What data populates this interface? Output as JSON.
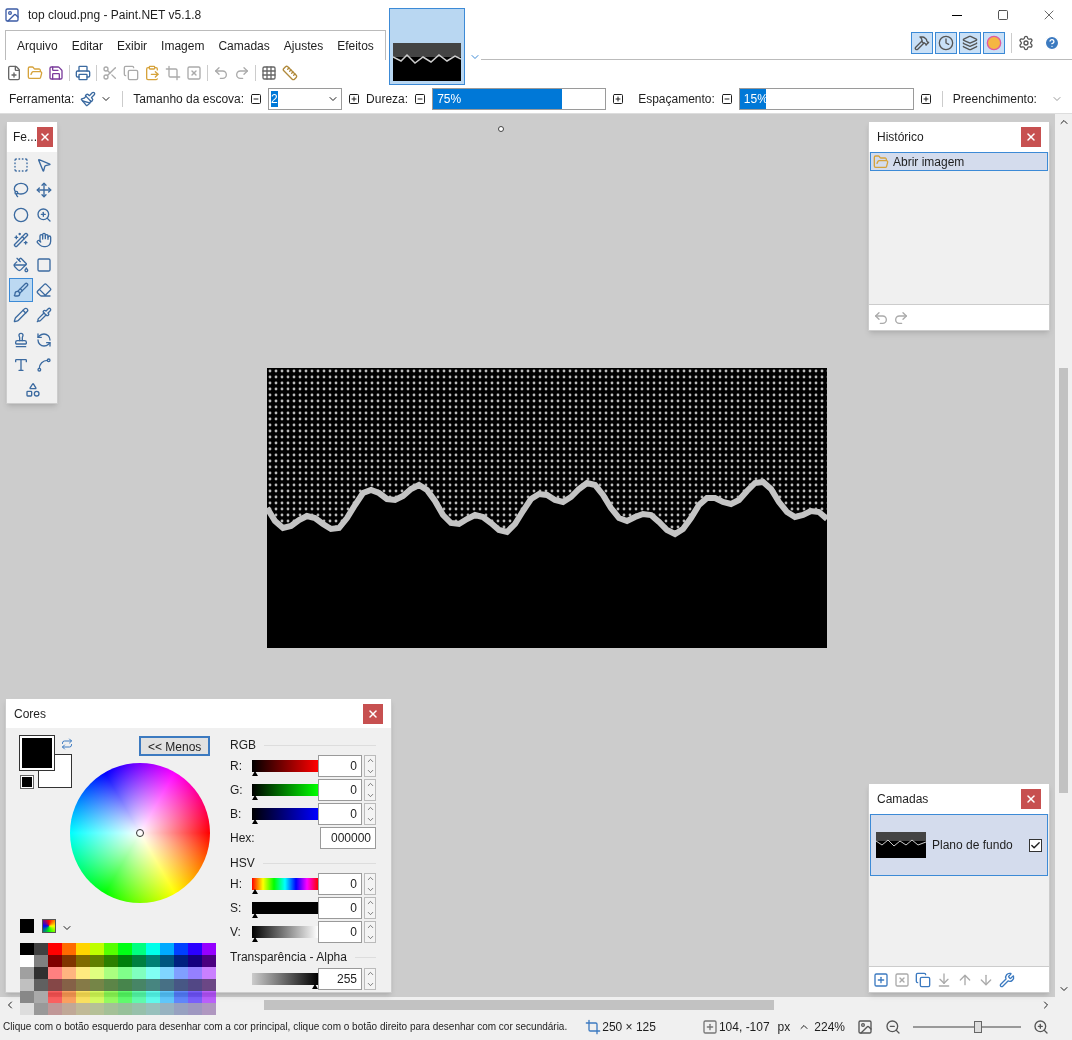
{
  "window": {
    "title": "top cloud.png - Paint.NET v5.1.8"
  },
  "menu": [
    "Arquivo",
    "Editar",
    "Exibir",
    "Imagem",
    "Camadas",
    "Ajustes",
    "Efeitos"
  ],
  "image_tabs": [
    {
      "selected": true
    }
  ],
  "panel_toggles": [
    {
      "selected": true
    },
    {
      "selected": true
    },
    {
      "selected": true
    },
    {
      "selected": true
    }
  ],
  "tool_options": {
    "tool_label": "Ferramenta:",
    "brush_size_label": "Tamanho da escova:",
    "brush_size": "2",
    "hardness_label": "Dureza:",
    "hardness": {
      "reading": "75%",
      "level": 0.75
    },
    "spacing_label": "Espaçamento:",
    "spacing": {
      "reading": "15%",
      "level": 0.15
    },
    "fill_label": "Preenchimento:"
  },
  "tools_panel": {
    "title": "Fe...",
    "tools": [
      {
        "selected": false
      },
      {
        "selected": false
      },
      {
        "selected": false
      },
      {
        "selected": false
      },
      {
        "selected": false
      },
      {
        "selected": false
      },
      {
        "selected": false
      },
      {
        "selected": false
      },
      {
        "selected": false
      },
      {
        "selected": false
      },
      {
        "selected": true
      },
      {
        "selected": false
      },
      {
        "selected": false
      },
      {
        "selected": false
      },
      {
        "selected": false
      },
      {
        "selected": false
      },
      {
        "selected": false
      },
      {
        "selected": false
      },
      {
        "selected": false
      }
    ]
  },
  "history_panel": {
    "title": "Histórico",
    "items": [
      {
        "label": "Abrir imagem",
        "selected": true
      }
    ]
  },
  "colors_panel": {
    "title": "Cores",
    "swatches": [
      {
        "kind": "primary",
        "color": "#000000"
      },
      {
        "kind": "secondary",
        "color": "#ffffff"
      }
    ],
    "less_button": "<< Menos",
    "rgb_label": "RGB",
    "rgb": [
      {
        "label": "R:",
        "value": "0",
        "level": 0
      },
      {
        "label": "G:",
        "value": "0",
        "level": 0
      },
      {
        "label": "B:",
        "value": "0",
        "level": 0
      }
    ],
    "hex_label": "Hex:",
    "hex": "000000",
    "hsv_label": "HSV",
    "hsv": [
      {
        "label": "H:",
        "value": "0",
        "level": 0
      },
      {
        "label": "S:",
        "value": "0",
        "level": 0
      },
      {
        "label": "V:",
        "value": "0",
        "level": 0
      }
    ],
    "alpha_label": "Transparência - Alpha",
    "alpha": "255",
    "alpha_slider": {
      "level": 1
    }
  },
  "layers_panel": {
    "title": "Camadas",
    "layers": [
      {
        "name": "Plano de fundo",
        "visible": true,
        "selected": true
      }
    ]
  },
  "status_bar": {
    "hint": "Clique com o botão esquerdo para desenhar com a cor principal, clique com o botão direito para desenhar com cor secundária.",
    "image_size": "250 × 125",
    "cursor": "104, -107",
    "unit": "px",
    "zoom": "224%",
    "zoom_slider": {
      "level": 0.6
    }
  }
}
